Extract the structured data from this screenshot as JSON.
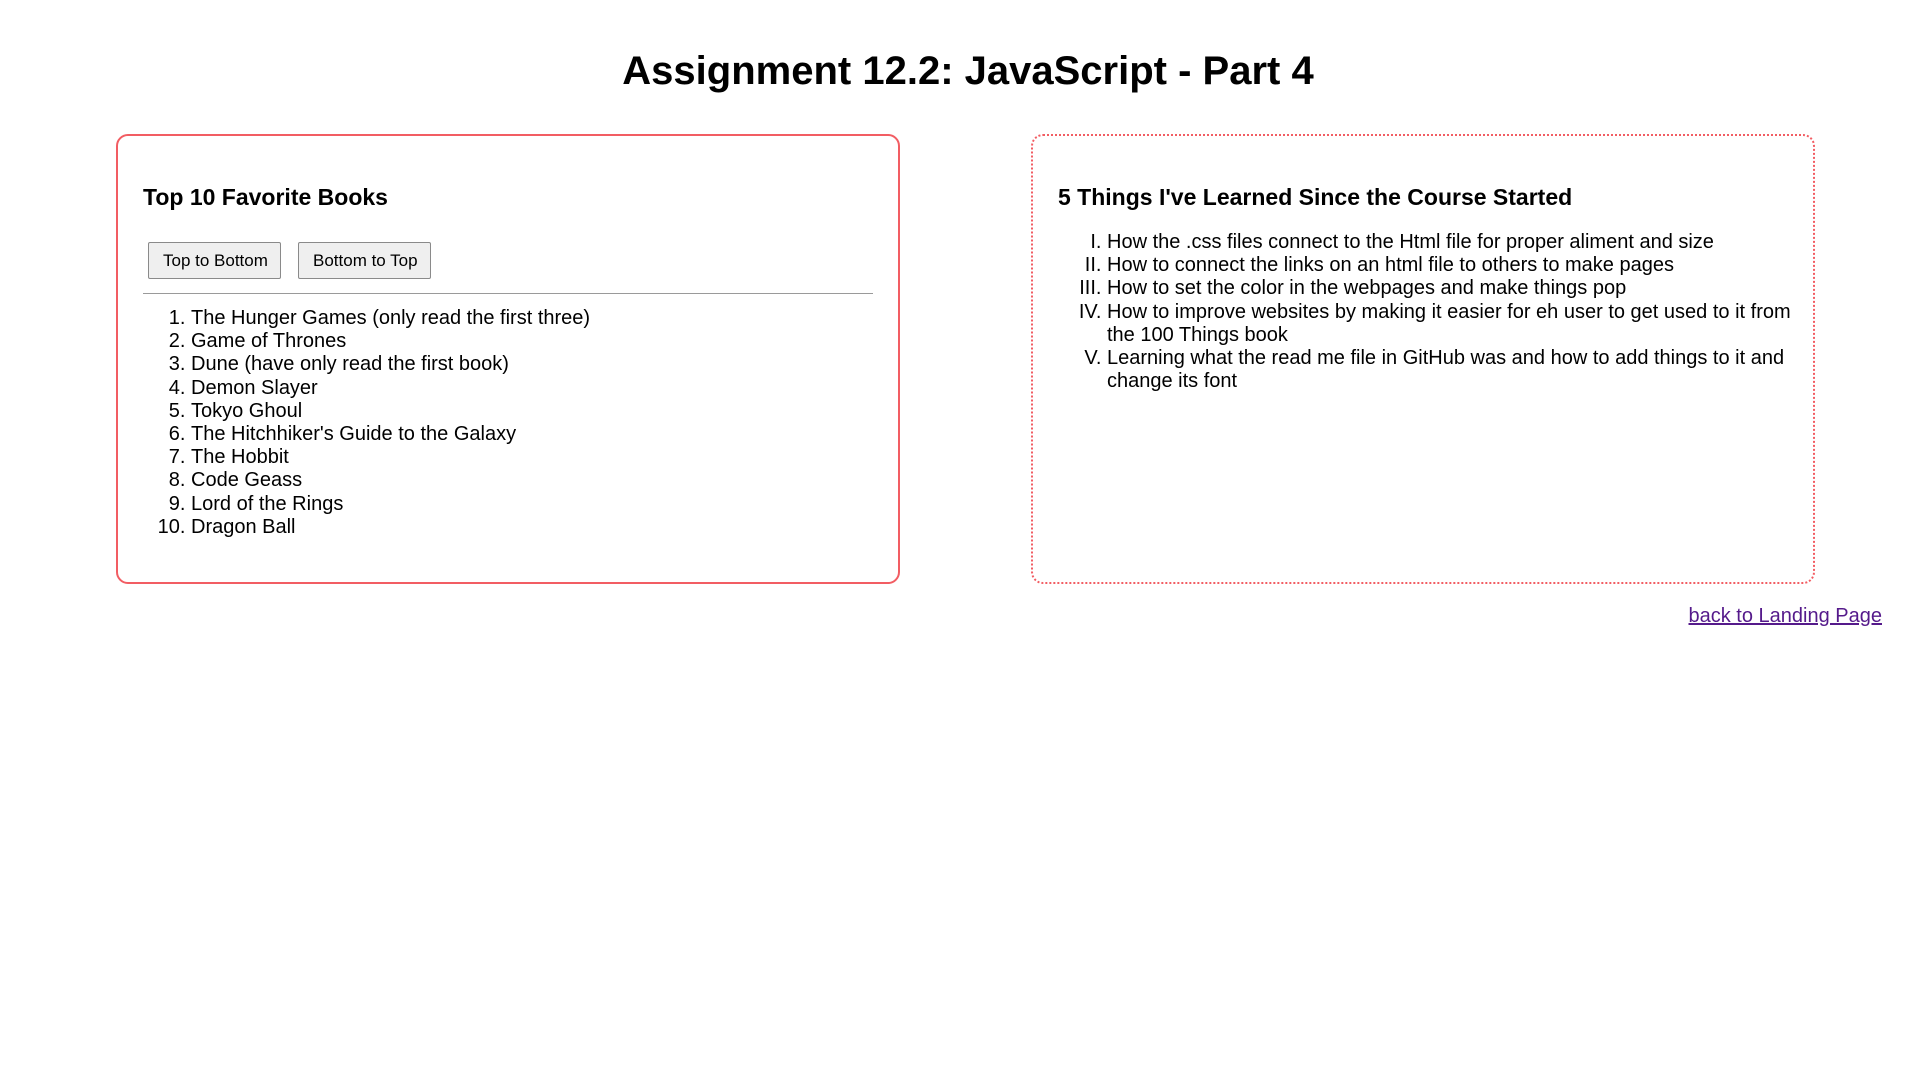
{
  "page": {
    "title": "Assignment 12.2: JavaScript - Part 4"
  },
  "books_panel": {
    "heading": "Top 10 Favorite Books",
    "buttons": {
      "top_to_bottom": "Top to Bottom",
      "bottom_to_top": "Bottom to Top"
    },
    "items": [
      "The Hunger Games (only read the first three)",
      "Game of Thrones",
      "Dune (have only read the first book)",
      "Demon Slayer",
      "Tokyo Ghoul",
      "The Hitchhiker's Guide to the Galaxy",
      "The Hobbit",
      "Code Geass",
      "Lord of the Rings",
      "Dragon Ball"
    ]
  },
  "learned_panel": {
    "heading": "5 Things I've Learned Since the Course Started",
    "items": [
      "How the .css files connect to the Html file for proper aliment and size",
      "How to connect the links on an html file to others to make pages",
      "How to set the color in the webpages and make things pop",
      "How to improve websites by making it easier for eh user to get used to it from the 100 Things book",
      "Learning what the read me file in GitHub was and how to add things to it and change its font"
    ]
  },
  "footer": {
    "back_link": "back to Landing Page"
  },
  "colors": {
    "panel_border": "#f25d63",
    "visited_link": "#551a8b",
    "button_bg": "#efefef"
  }
}
